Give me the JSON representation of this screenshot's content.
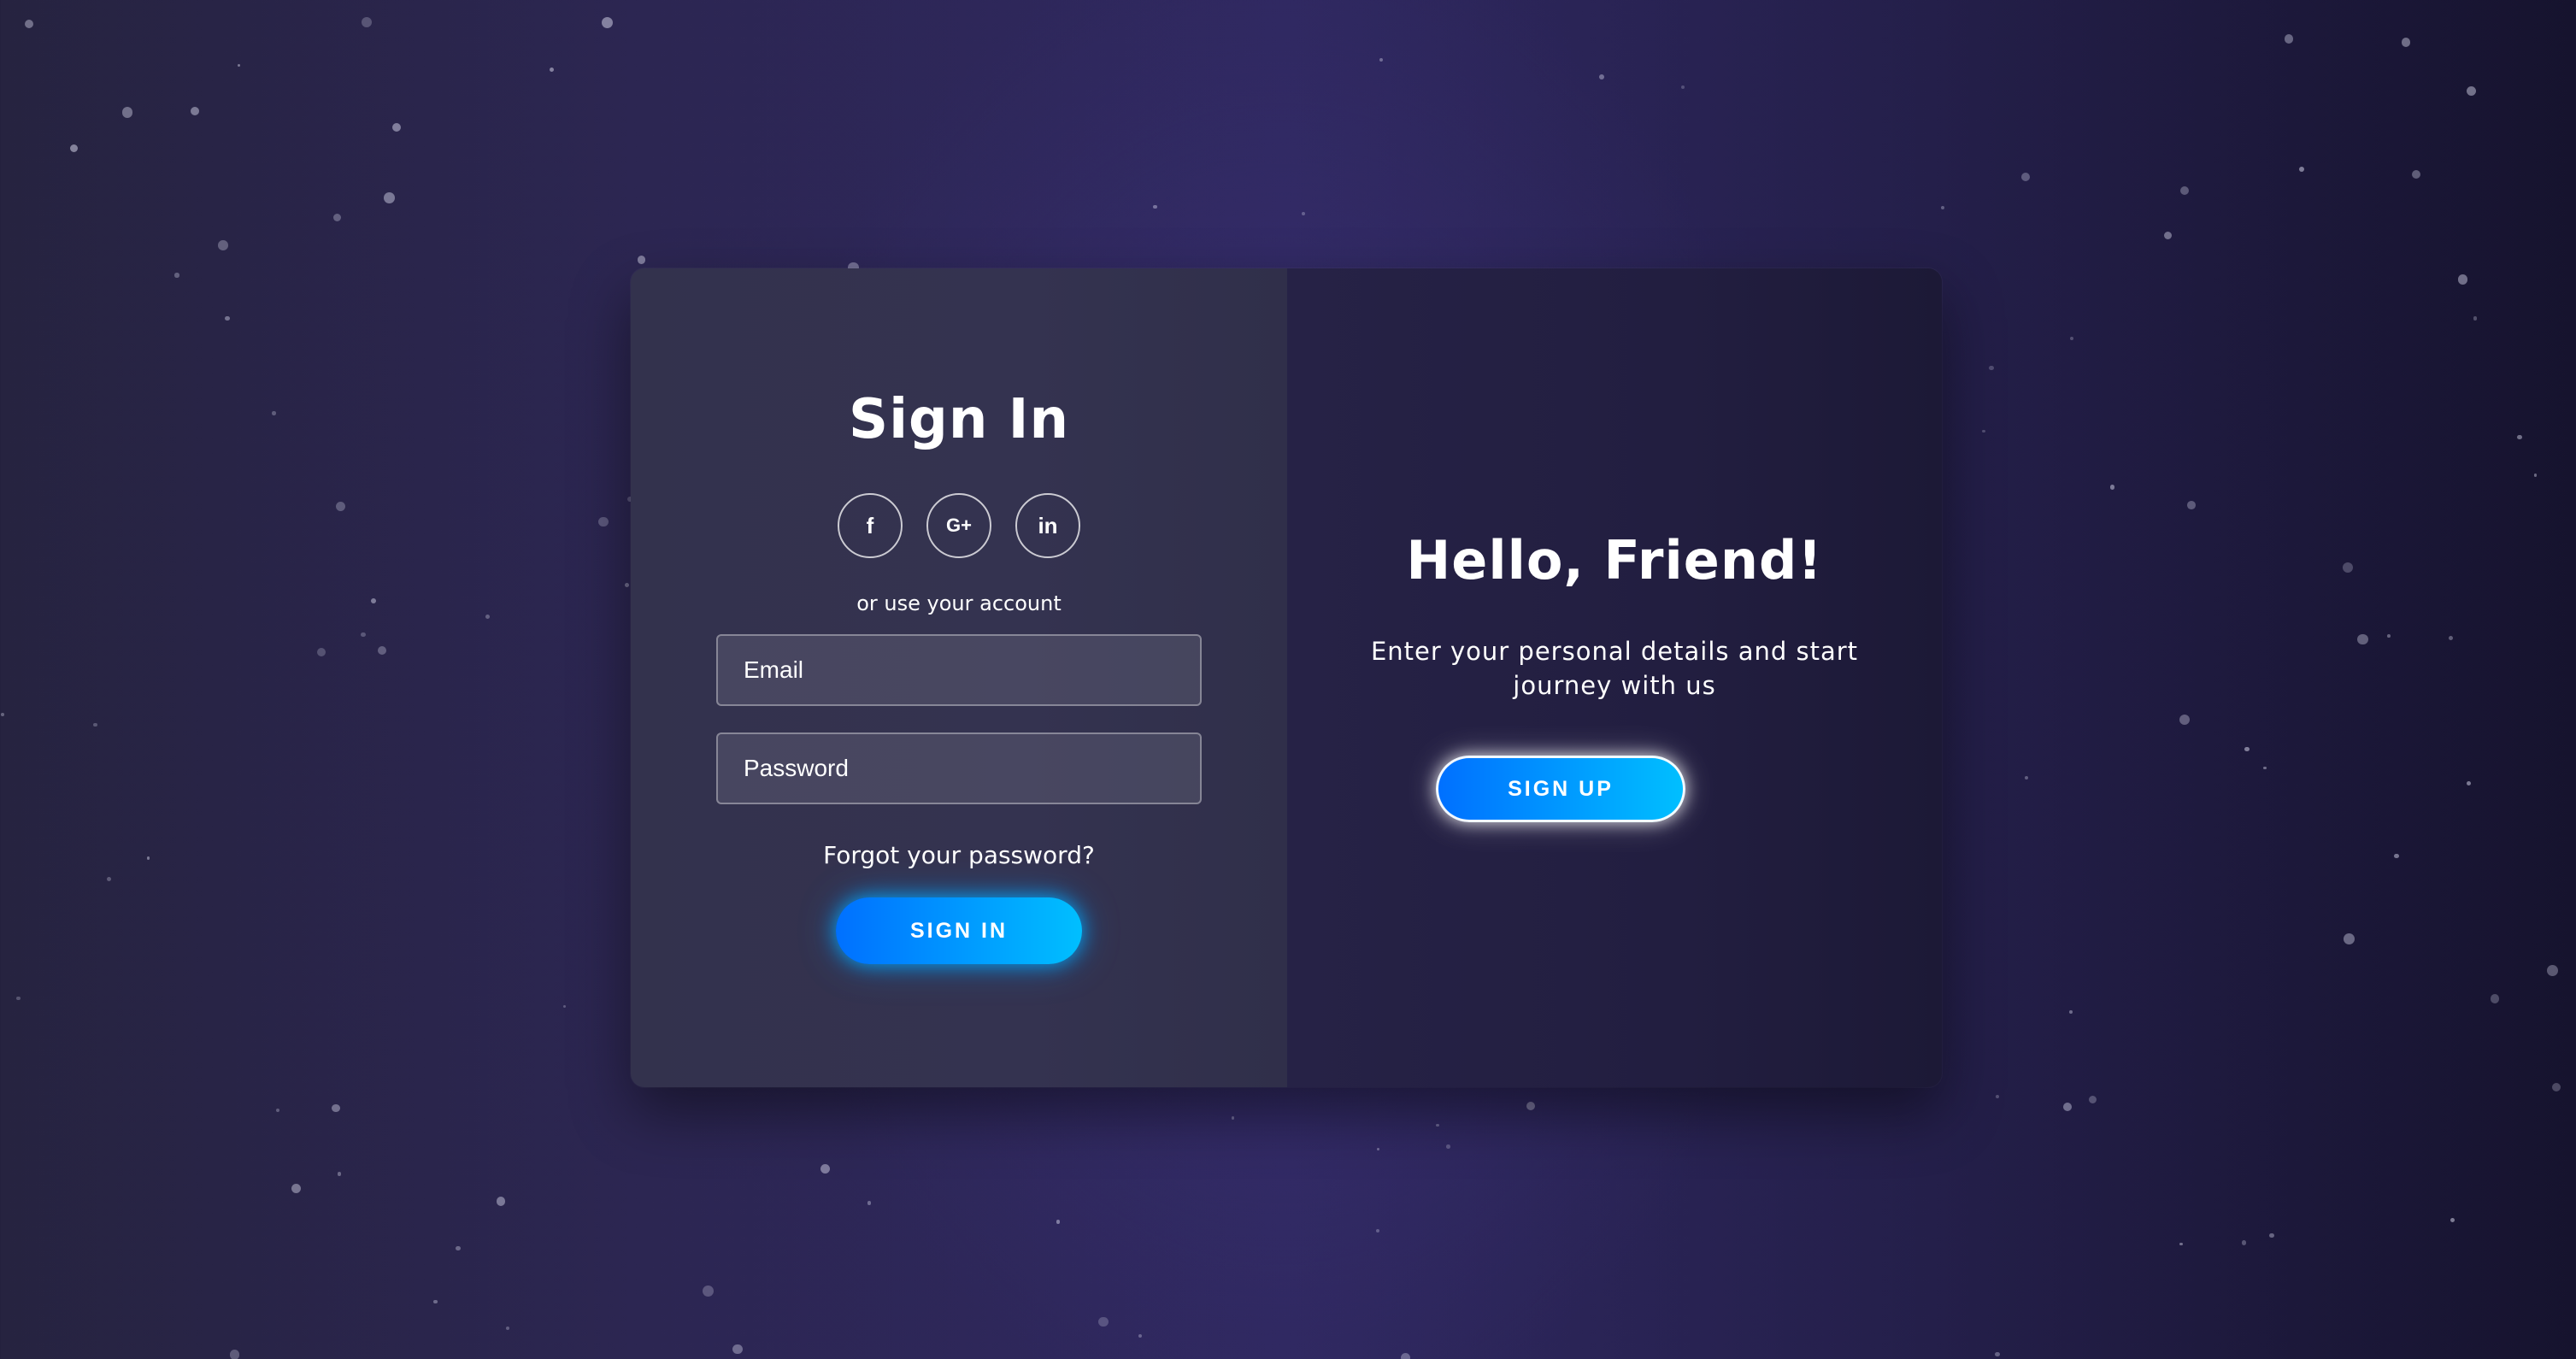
{
  "sign_in": {
    "title": "Sign In",
    "socials": [
      {
        "icon": "facebook-icon",
        "glyph": "f"
      },
      {
        "icon": "google-plus-icon",
        "glyph": "G+"
      },
      {
        "icon": "linkedin-icon",
        "glyph": "in"
      }
    ],
    "or_text": "or use your account",
    "email_placeholder": "Email",
    "password_placeholder": "Password",
    "forgot_text": "Forgot your password?",
    "button_label": "SIGN IN"
  },
  "sign_up": {
    "title": "Hello, Friend!",
    "subtitle_line1": "Enter your personal details and start",
    "subtitle_line2": "journey with us",
    "button_label": "SIGN UP"
  },
  "colors": {
    "button_gradient_start": "#0070ff",
    "button_gradient_end": "#00bfff",
    "background": "#2c2652"
  }
}
